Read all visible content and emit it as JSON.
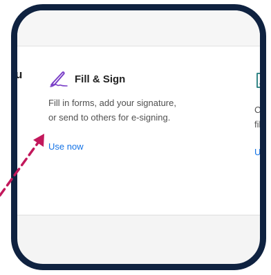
{
  "section": {
    "heading_fragment": "u"
  },
  "tools": [
    {
      "icon": "fill-sign-pen-icon",
      "title": "Fill & Sign",
      "description": "Fill in forms, add your signature,\nor send to others for e-signing.",
      "link": "Use now"
    },
    {
      "icon": "acrobat-pdf-icon",
      "description": "Co\nfile",
      "link": "Us"
    }
  ],
  "colors": {
    "frame_border": "#0f2240",
    "link": "#1473e6",
    "fill_sign_icon": "#7a3fc7",
    "pdf_icon": "#1f7a7a",
    "arrow": "#c2185b"
  }
}
